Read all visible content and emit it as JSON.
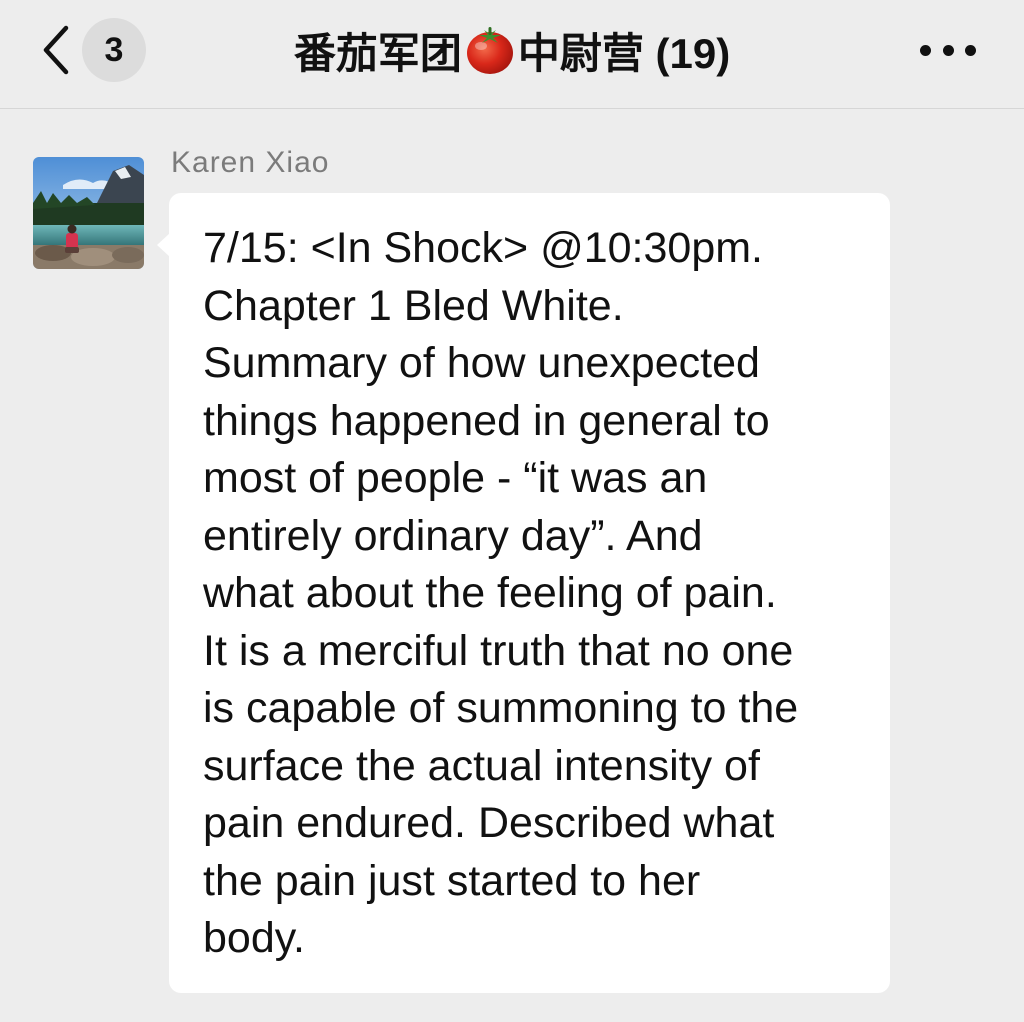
{
  "nav": {
    "back_icon": "chevron-left-icon",
    "unread_count": "3",
    "title_prefix": "番茄军团",
    "title_icon": "tomato-icon",
    "title_suffix": "中尉营 (19)",
    "more_icon": "more-horizontal-icon"
  },
  "message": {
    "sender": "Karen Xiao",
    "avatar_icon": "avatar-photo",
    "text": "7/15: <In Shock> @10:30pm.\nChapter 1 Bled White.\nSummary of how unexpected\nthings happened in general to\nmost of people - “it was an\nentirely ordinary day”. And\nwhat about the feeling of pain.\nIt is a merciful truth that no one\nis capable of summoning to the\nsurface the actual intensity of\npain endured. Described what\nthe pain just started to her\nbody."
  },
  "colors": {
    "background": "#ededed",
    "bubble": "#ffffff",
    "text": "#111111",
    "sender_name": "#7b7b7b",
    "badge": "#dcdcdc"
  }
}
